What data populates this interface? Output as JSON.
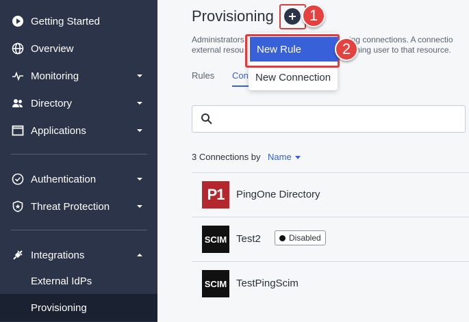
{
  "sidebar": {
    "items": [
      {
        "label": "Getting Started",
        "icon": "play-circle-icon"
      },
      {
        "label": "Overview",
        "icon": "globe-icon"
      },
      {
        "label": "Monitoring",
        "icon": "pulse-icon"
      },
      {
        "label": "Directory",
        "icon": "users-icon"
      },
      {
        "label": "Applications",
        "icon": "window-icon"
      },
      {
        "label": "Authentication",
        "icon": "check-circle-icon"
      },
      {
        "label": "Threat Protection",
        "icon": "shield-icon"
      },
      {
        "label": "Integrations",
        "icon": "plug-icon"
      }
    ],
    "subitems": [
      {
        "label": "External IdPs"
      },
      {
        "label": "Provisioning"
      }
    ]
  },
  "header": {
    "title": "Provisioning",
    "description_line1": "Administrators                                              ing connections. A connectio",
    "description_line2": "external resou                                               oning user to that resource."
  },
  "tabs": [
    {
      "label": "Rules"
    },
    {
      "label": "Con"
    }
  ],
  "dropdown": {
    "items": [
      {
        "label": "New Rule"
      },
      {
        "label": "New Connection"
      }
    ]
  },
  "callouts": [
    "1",
    "2"
  ],
  "search": {
    "placeholder": ""
  },
  "list": {
    "count_label": "3 Connections by",
    "sort_label": "Name",
    "rows": [
      {
        "name": "PingOne Directory",
        "logo": "P1",
        "status": ""
      },
      {
        "name": "Test2",
        "logo": "SCIM",
        "status": "Disabled"
      },
      {
        "name": "TestPingScim",
        "logo": "SCIM",
        "status": ""
      }
    ]
  },
  "colors": {
    "sidebar_bg": "#2b3449",
    "accent": "#3860d8",
    "callout": "#e5413f",
    "p1_logo": "#b3272d"
  }
}
